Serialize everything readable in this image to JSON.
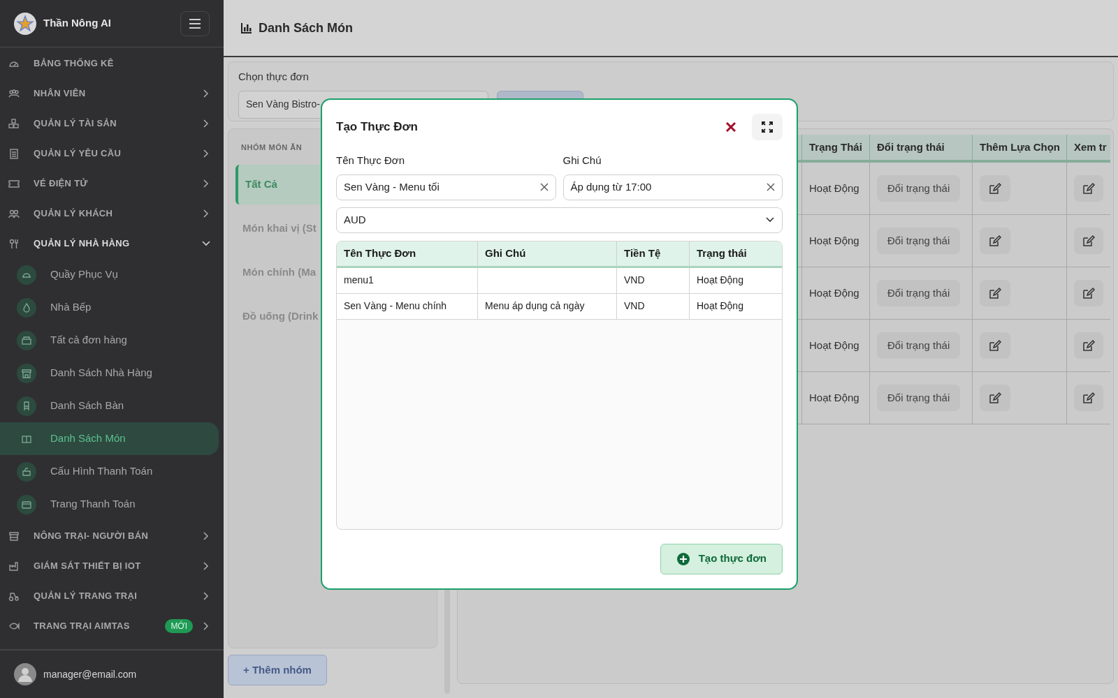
{
  "sidebar": {
    "brand": "Thần Nông AI",
    "items": [
      {
        "label": "BẢNG THỐNG KÊ",
        "kind": "link"
      },
      {
        "label": "NHÂN VIÊN",
        "kind": "group",
        "expanded": false
      },
      {
        "label": "QUẢN LÝ TÀI SẢN",
        "kind": "group",
        "expanded": false
      },
      {
        "label": "QUẢN LÝ YÊU CẦU",
        "kind": "group",
        "expanded": false
      },
      {
        "label": "VÉ ĐIỆN TỬ",
        "kind": "group",
        "expanded": false
      },
      {
        "label": "QUẢN LÝ KHÁCH",
        "kind": "group",
        "expanded": false
      },
      {
        "label": "QUẢN LÝ NHÀ HÀNG",
        "kind": "group",
        "expanded": true,
        "children": [
          {
            "label": "Quầy Phục Vụ",
            "selected": false
          },
          {
            "label": "Nhà Bếp",
            "selected": false
          },
          {
            "label": "Tất cả đơn hàng",
            "selected": false
          },
          {
            "label": "Danh Sách Nhà Hàng",
            "selected": false
          },
          {
            "label": "Danh Sách Bàn",
            "selected": false
          },
          {
            "label": "Danh Sách Món",
            "selected": true
          },
          {
            "label": "Cấu Hình Thanh Toán",
            "selected": false
          },
          {
            "label": "Trang Thanh Toán",
            "selected": false
          }
        ]
      },
      {
        "label": "NÔNG TRẠI- NGƯỜI BÁN",
        "kind": "group",
        "expanded": false
      },
      {
        "label": "GIÁM SÁT THIẾT BỊ IOT",
        "kind": "group",
        "expanded": false
      },
      {
        "label": "QUẢN LÝ TRANG TRẠI",
        "kind": "group",
        "expanded": false
      },
      {
        "label": "TRANG TRẠI AIMTAS",
        "kind": "group",
        "expanded": false,
        "badge": "MỚI"
      }
    ],
    "user": {
      "email": "manager@email.com"
    }
  },
  "header": {
    "title": "Danh Sách Món"
  },
  "menu_picker": {
    "label": "Chọn thực đơn",
    "value": "Sen Vàng Bistro-"
  },
  "groups": {
    "heading": "NHÓM MÓN ĂN",
    "items": [
      {
        "label": "Tất Cả",
        "selected": true
      },
      {
        "label": "Món khai vị (St",
        "selected": false
      },
      {
        "label": "Món chính (Ma",
        "selected": false
      },
      {
        "label": "Đồ uống (Drink",
        "selected": false
      }
    ],
    "add_button": "+ Thêm nhóm"
  },
  "dish_table": {
    "columns": [
      "Trạng Thái",
      "Đổi trạng thái",
      "Thêm Lựa Chọn",
      "Xem tr"
    ],
    "rows": [
      {
        "status": "Hoạt Động",
        "action": "Đổi trạng thái"
      },
      {
        "status": "Hoạt Động",
        "action": "Đổi trạng thái"
      },
      {
        "status": "Hoạt Động",
        "action": "Đổi trạng thái"
      },
      {
        "status": "Hoạt Động",
        "action": "Đổi trạng thái"
      },
      {
        "status": "Hoạt Động",
        "action": "Đổi trạng thái"
      }
    ]
  },
  "modal": {
    "title": "Tạo Thực Đơn",
    "fields": [
      {
        "label": "Tên Thực Đơn",
        "value": "Sen Vàng - Menu tối"
      },
      {
        "label": "Ghi Chú",
        "value": "Áp dụng từ 17:00"
      }
    ],
    "currency": {
      "value": "AUD"
    },
    "table": {
      "columns": [
        "Tên Thực Đơn",
        "Ghi Chú",
        "Tiền Tệ",
        "Trạng thái"
      ],
      "rows": [
        [
          "menu1",
          "",
          "VND",
          "Hoạt Động"
        ],
        [
          "Sen Vàng - Menu chính",
          "Menu áp dụng cả ngày",
          "VND",
          "Hoạt Động"
        ]
      ]
    },
    "submit": "Tạo thực đơn"
  }
}
